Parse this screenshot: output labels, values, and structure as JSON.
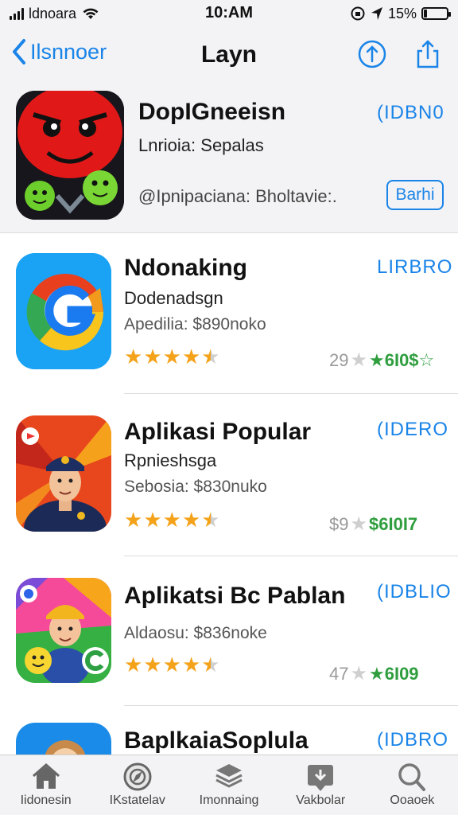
{
  "status_bar": {
    "carrier": "ldnoara",
    "time": "10:AM",
    "battery": "15%",
    "battery_level": 0.15
  },
  "nav": {
    "back_label": "Ilsnnoer",
    "title": "Layn",
    "icons": [
      "upload-circle-icon",
      "share-icon"
    ]
  },
  "featured": {
    "name": "DopIGneeisn",
    "subtitle": "Lnrioia: Sepalas",
    "meta": "@Ipnipaciana: Bholtavie:.",
    "get_label": "(IDBN0",
    "action_label": "Barhi"
  },
  "apps": [
    {
      "name": "Ndonaking",
      "subtitle": "Dodenadsgn",
      "meta": "Apedilia: $890noko",
      "get_label": "LIRBRO",
      "rating": 4.5,
      "review_count": "29",
      "review_value": "★6I0$☆"
    },
    {
      "name": "Aplikasi Popular",
      "subtitle": "Rpnieshsga",
      "meta": "Sebosia: $830nuko",
      "get_label": "(IDERO",
      "rating": 4.5,
      "review_count": "$9",
      "review_value": "$6I0I7"
    },
    {
      "name": "Aplikatsi Bc Pablan",
      "subtitle": "",
      "meta": "Aldaosu: $836noke",
      "get_label": "(IDBLIO",
      "rating": 4.5,
      "review_count": "47",
      "review_value": "★6I09"
    },
    {
      "name": "BaplkaiaSoplula",
      "subtitle": "",
      "meta": "",
      "get_label": "(IDBRO"
    }
  ],
  "tabs": [
    {
      "label": "Iidonesin",
      "icon": "home-icon"
    },
    {
      "label": "IKstatelav",
      "icon": "compass-icon"
    },
    {
      "label": "Imonnaing",
      "icon": "layers-icon"
    },
    {
      "label": "Vakbolar",
      "icon": "updates-icon"
    },
    {
      "label": "Ooaoek",
      "icon": "search-icon"
    }
  ],
  "colors": {
    "accent": "#1a84e8",
    "star": "#f4a21a",
    "review_value": "#2f9e3e",
    "bar_background": "#f3f3f5"
  }
}
